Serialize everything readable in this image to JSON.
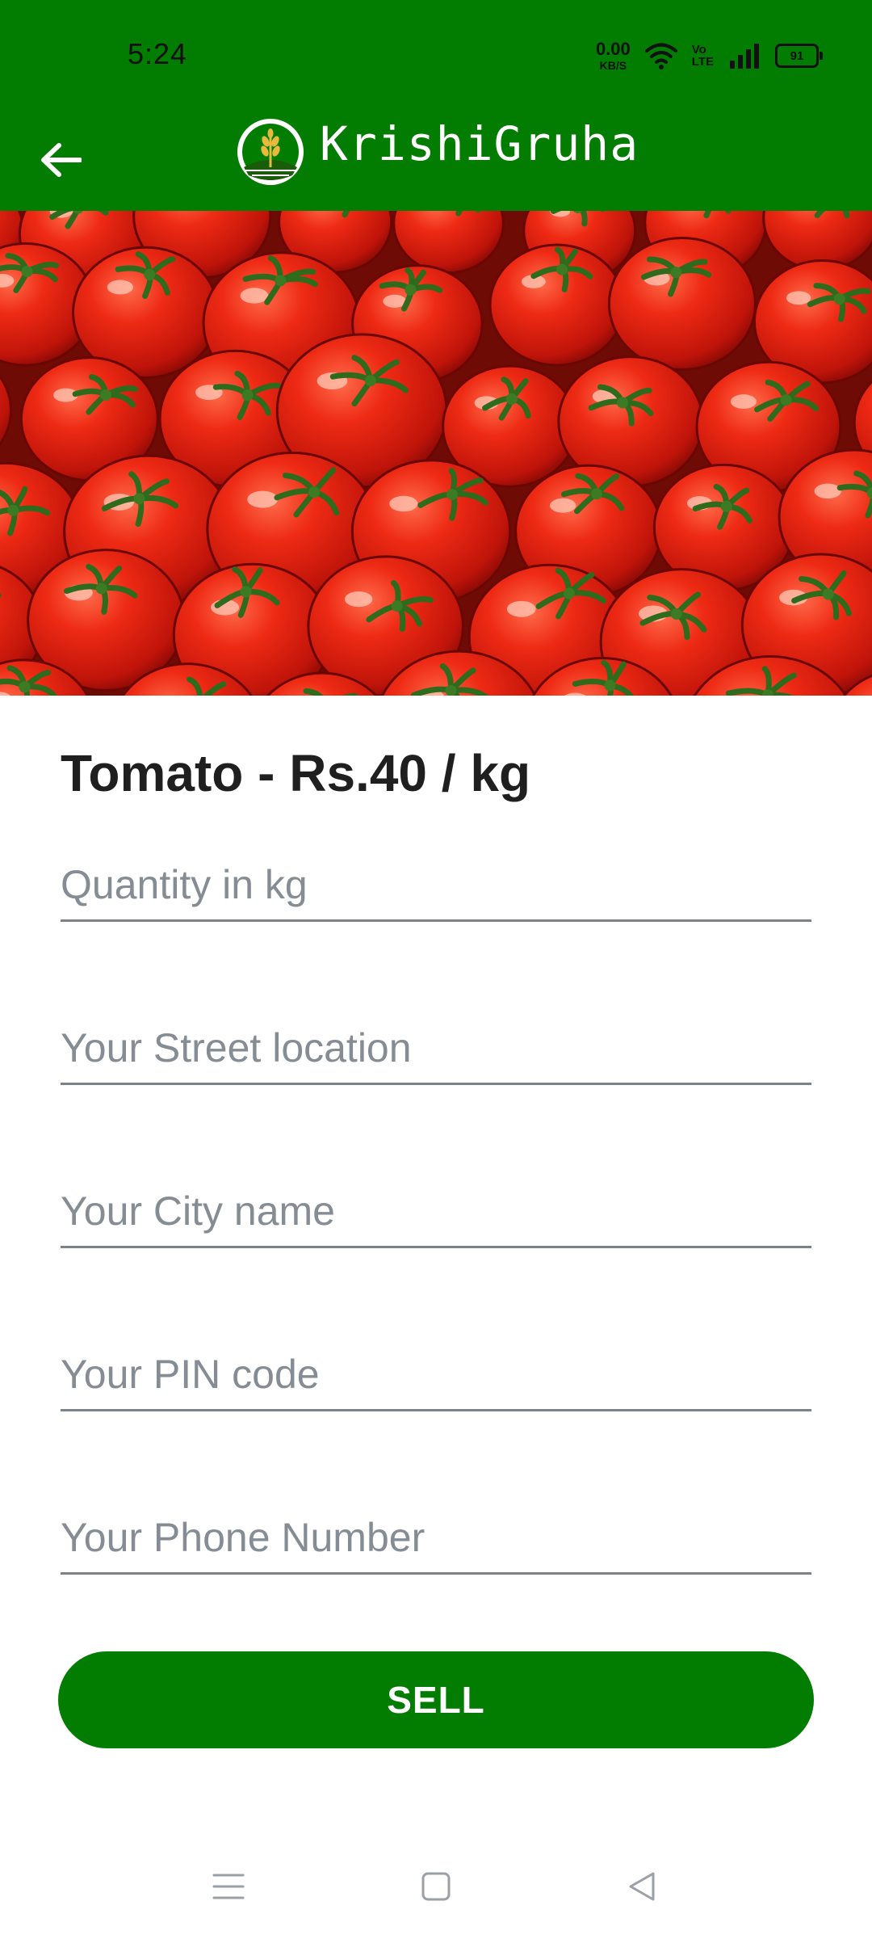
{
  "status_bar": {
    "time": "5:24",
    "net_speed_value": "0.00",
    "net_speed_unit": "KB/S",
    "volte_top": "Vo",
    "volte_bottom": "LTE",
    "battery": "91"
  },
  "app_bar": {
    "title": "KrishiGruha"
  },
  "product": {
    "title": "Tomato - Rs.40 / kg"
  },
  "form": {
    "quantity_placeholder": "Quantity in kg",
    "street_placeholder": "Your Street location",
    "city_placeholder": "Your City name",
    "pin_placeholder": "Your PIN code",
    "phone_placeholder": "Your Phone Number"
  },
  "actions": {
    "sell_label": "SELL"
  },
  "colors": {
    "primary": "#037c02",
    "text": "#1f1f1f",
    "placeholder": "#858c93",
    "underline": "#7a828a"
  }
}
